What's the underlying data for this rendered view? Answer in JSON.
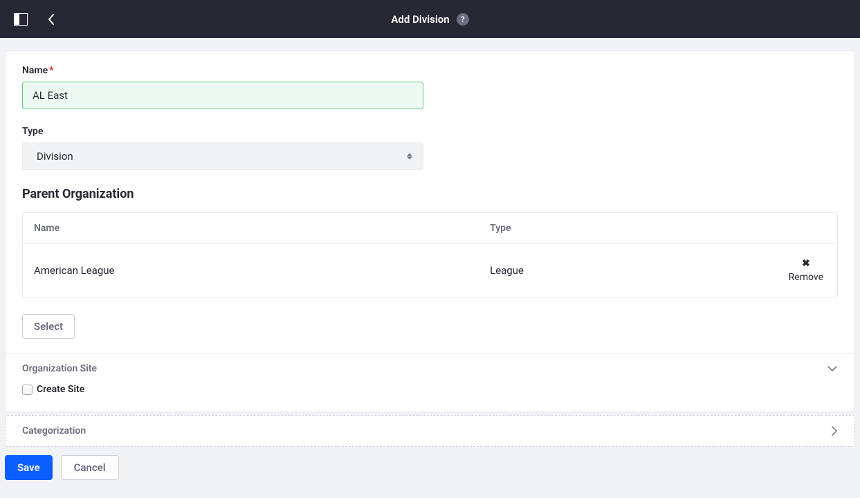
{
  "header": {
    "title": "Add Division"
  },
  "form": {
    "nameLabel": "Name",
    "nameValue": "AL East",
    "typeLabel": "Type",
    "typeValue": "Division",
    "parentHeading": "Parent Organization",
    "table": {
      "colName": "Name",
      "colType": "Type",
      "rowName": "American League",
      "rowType": "League",
      "removeLabel": "Remove"
    },
    "selectButton": "Select"
  },
  "orgSite": {
    "title": "Organization Site",
    "createSiteLabel": "Create Site"
  },
  "categorization": {
    "title": "Categorization"
  },
  "footer": {
    "save": "Save",
    "cancel": "Cancel"
  }
}
